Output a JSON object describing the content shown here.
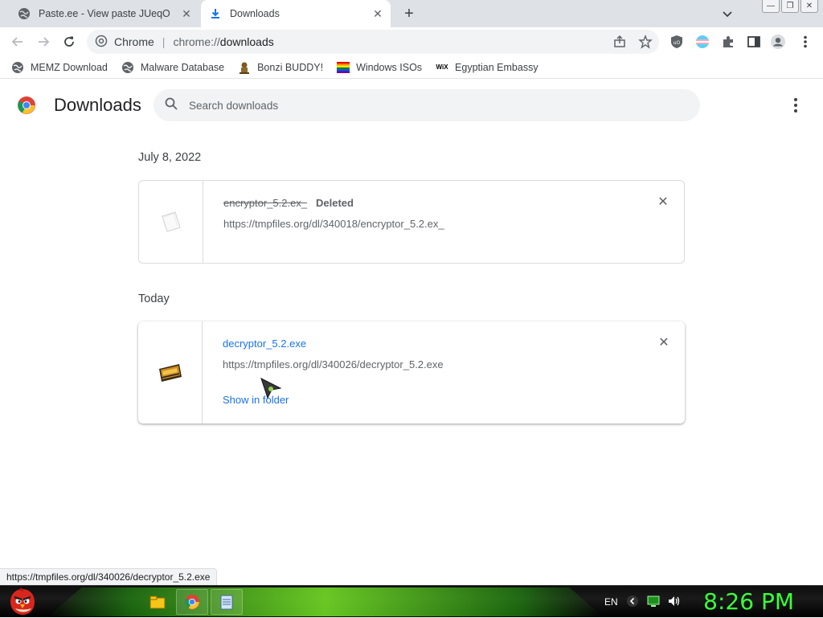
{
  "tabs": [
    {
      "title": "Paste.ee - View paste JUeqO",
      "icon": "globe-icon",
      "active": false
    },
    {
      "title": "Downloads",
      "icon": "download-icon",
      "active": true
    }
  ],
  "window_controls": {
    "minimize": "—",
    "restore": "❐",
    "close": "✕"
  },
  "omnibox": {
    "site_label": "Chrome",
    "separator": "|",
    "url_scheme": "chrome://",
    "url_path": "downloads"
  },
  "bookmarks": [
    {
      "label": "MEMZ Download",
      "icon": "globe-icon"
    },
    {
      "label": "Malware Database",
      "icon": "globe-icon"
    },
    {
      "label": "Bonzi BUDDY!",
      "icon": "bonzi-icon"
    },
    {
      "label": "Windows ISOs",
      "icon": "windows-flag-icon"
    },
    {
      "label": "Egyptian Embassy",
      "icon": "wix-icon",
      "icon_text": "WiX"
    }
  ],
  "page": {
    "title": "Downloads",
    "search_placeholder": "Search downloads"
  },
  "groups": [
    {
      "date": "July 8, 2022",
      "items": [
        {
          "filename": "encryptor_5.2.ex_",
          "status": "Deleted",
          "url": "https://tmpfiles.org/dl/340018/encryptor_5.2.ex_",
          "state": "deleted"
        }
      ]
    },
    {
      "date": "Today",
      "items": [
        {
          "filename": "decryptor_5.2.exe",
          "status": "",
          "url": "https://tmpfiles.org/dl/340026/decryptor_5.2.exe",
          "action": "Show in folder",
          "state": "complete"
        }
      ]
    }
  ],
  "status_bubble": "https://tmpfiles.org/dl/340026/decryptor_5.2.exe",
  "taskbar": {
    "language": "EN",
    "clock": "8:26 PM",
    "clock_color": "#3cff3c"
  },
  "colors": {
    "link": "#1a73e8",
    "accent_green": "#3cff3c"
  }
}
